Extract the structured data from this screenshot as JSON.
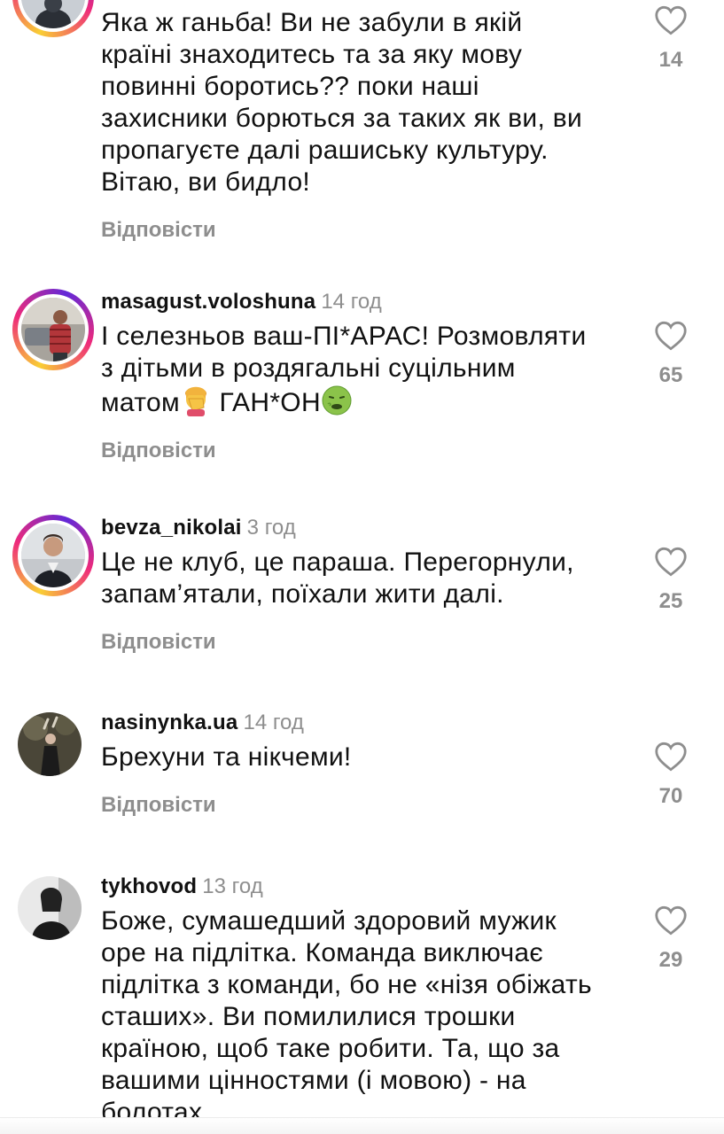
{
  "reply_label": "Відповісти",
  "colors": {
    "muted": "#8e8e8e",
    "text": "#111111",
    "ring": "#ee2a7b"
  },
  "comments": [
    {
      "username": "",
      "time": "",
      "lines": [
        "Яка ж ганьба! Ви не забули в якій",
        "країні знаходитесь та за яку мову",
        "повинні боротись?? поки наші",
        "захисники борються за таких як ви, ви",
        "пропагуєте далі рашиську культуру.",
        "Вітаю, ви бидло!"
      ],
      "likes": "14",
      "has_story_ring": true
    },
    {
      "username": "masagust.voloshuna",
      "time": "14 год",
      "lines": [
        "І селезньов ваш-ПІ*АРАС! Розмовляти",
        "з дітьми в роздягальні суцільним"
      ],
      "line3_before_emoji": "матом",
      "line3_mid": " ГАН*ОН",
      "emoji_1": "face-palm-emoji",
      "emoji_2": "nauseated-face-emoji",
      "likes": "65",
      "has_story_ring": true
    },
    {
      "username": "bevza_nikolai",
      "time": "3 год",
      "lines": [
        "Це не клуб, це параша. Перегорнули,",
        "запам’ятали, поїхали жити далі."
      ],
      "likes": "25",
      "has_story_ring": true
    },
    {
      "username": "nasinynka.ua",
      "time": "14 год",
      "lines": [
        "Брехуни та нікчеми!"
      ],
      "likes": "70",
      "has_story_ring": false
    },
    {
      "username": "tykhovod",
      "time": "13 год",
      "lines": [
        "Боже, сумашедший здоровий мужик",
        "оре на підлітка. Команда виключає",
        "підлітка з команди, бо не «нізя обіжать",
        "сташих». Ви помилилися трошки",
        "країною, щоб таке робити. Та, що за",
        "вашими цінностями (і мовою) - на",
        "болотах"
      ],
      "likes": "29",
      "has_story_ring": false
    }
  ]
}
